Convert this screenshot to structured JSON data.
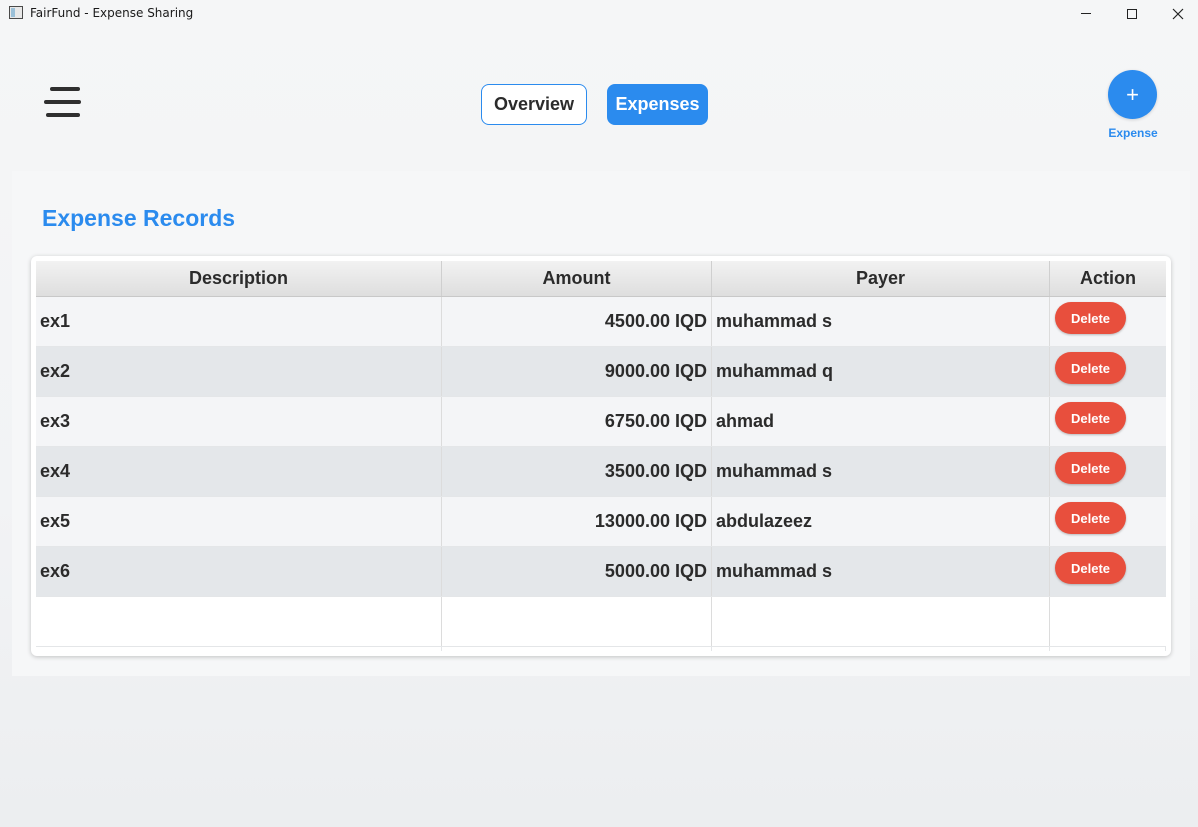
{
  "window": {
    "title": "FairFund - Expense Sharing"
  },
  "nav": {
    "menu_icon": "hamburger-menu-icon",
    "tabs": [
      {
        "label": "Overview",
        "active": false
      },
      {
        "label": "Expenses",
        "active": true
      }
    ],
    "add_button": {
      "symbol": "+",
      "label": "Expense"
    }
  },
  "colors": {
    "accent": "#2b8bee",
    "danger": "#e84f3d"
  },
  "section": {
    "title": "Expense Records"
  },
  "table": {
    "columns": [
      "Description",
      "Amount",
      "Payer",
      "Action"
    ],
    "rows": [
      {
        "description": "ex1",
        "amount": "4500.00 IQD",
        "payer": "muhammad s",
        "action": "Delete"
      },
      {
        "description": "ex2",
        "amount": "9000.00 IQD",
        "payer": "muhammad q",
        "action": "Delete"
      },
      {
        "description": "ex3",
        "amount": "6750.00 IQD",
        "payer": "ahmad",
        "action": "Delete"
      },
      {
        "description": "ex4",
        "amount": "3500.00 IQD",
        "payer": "muhammad s",
        "action": "Delete"
      },
      {
        "description": "ex5",
        "amount": "13000.00 IQD",
        "payer": "abdulazeez",
        "action": "Delete"
      },
      {
        "description": "ex6",
        "amount": "5000.00 IQD",
        "payer": "muhammad s",
        "action": "Delete"
      }
    ]
  }
}
